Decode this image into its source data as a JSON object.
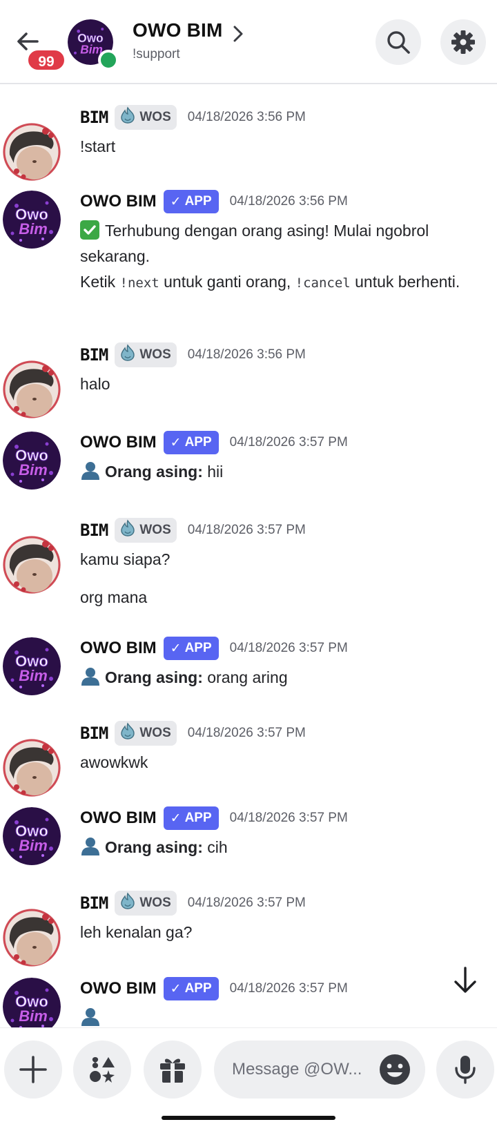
{
  "header": {
    "unread_count": "99",
    "channel_title": "OWO BIM",
    "channel_subtitle": "!support"
  },
  "avatar_text": {
    "line1": "Owo",
    "line2": "Bim"
  },
  "messages": [
    {
      "author": "BIM",
      "tag": "WOS",
      "time": "04/18/2026 3:56 PM",
      "text": "!start"
    },
    {
      "author": "OWO BIM",
      "tag": "APP",
      "time": "04/18/2026 3:56 PM",
      "line1": "Terhubung dengan orang asing! Mulai ngobrol sekarang.",
      "line2_a": "Ketik ",
      "line2_code1": "!next",
      "line2_b": " untuk ganti orang, ",
      "line2_code2": "!cancel",
      "line2_c": " untuk berhenti."
    },
    {
      "author": "BIM",
      "tag": "WOS",
      "time": "04/18/2026 3:56 PM",
      "text": "halo"
    },
    {
      "author": "OWO BIM",
      "tag": "APP",
      "time": "04/18/2026 3:57 PM",
      "label": "Orang asing:",
      "text": " hii"
    },
    {
      "author": "BIM",
      "tag": "WOS",
      "time": "04/18/2026 3:57 PM",
      "text": "kamu siapa?",
      "text2": "org mana"
    },
    {
      "author": "OWO BIM",
      "tag": "APP",
      "time": "04/18/2026 3:57 PM",
      "label": "Orang asing:",
      "text": " orang aring"
    },
    {
      "author": "BIM",
      "tag": "WOS",
      "time": "04/18/2026 3:57 PM",
      "text": "awowkwk"
    },
    {
      "author": "OWO BIM",
      "tag": "APP",
      "time": "04/18/2026 3:57 PM",
      "label": "Orang asing:",
      "text": " cih"
    },
    {
      "author": "BIM",
      "tag": "WOS",
      "time": "04/18/2026 3:57 PM",
      "text": "leh kenalan ga?"
    },
    {
      "author": "OWO BIM",
      "tag": "APP",
      "time": "04/18/2026 3:57 PM"
    }
  ],
  "composer": {
    "placeholder": "Message @OW..."
  },
  "colors": {
    "accent": "#5865f2",
    "badge": "#e03a47",
    "online": "#23a55a"
  }
}
